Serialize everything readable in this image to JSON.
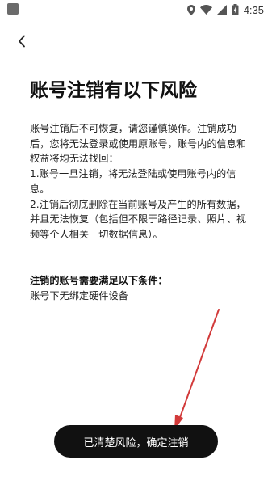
{
  "status_bar": {
    "time": "4:35",
    "icons": [
      "location-icon",
      "wifi-icon",
      "signal-icon",
      "battery-icon"
    ]
  },
  "nav": {
    "back_icon": "chevron-left-icon"
  },
  "page": {
    "title": "账号注销有以下风险",
    "warnings": [
      "账号注销后不可恢复，请您谨慎操作。注销成功后，您将无法登录或使用原账号，账号内的信息和权益将均无法找回：",
      "1.账号一旦注销，将无法登陆或使用账号内的信息。",
      "2.注销后彻底删除在当前账号及产生的所有数据，并且无法恢复（包括但不限于路径记录、照片、视频等个人相关一切数据信息）。"
    ],
    "conditions_heading": "注销的账号需要满足以下条件：",
    "conditions": [
      "账号下无绑定硬件设备"
    ]
  },
  "actions": {
    "confirm_label": "已清楚风险，确定注销"
  },
  "colors": {
    "button_bg": "#111111",
    "annotation_arrow": "#d23a3a"
  }
}
